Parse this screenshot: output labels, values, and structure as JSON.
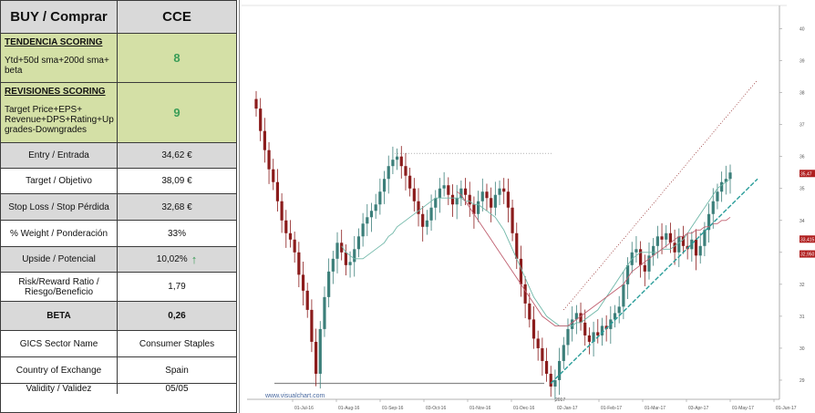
{
  "table": {
    "header": {
      "label": "BUY / Comprar",
      "ticker": "CCE"
    },
    "tendencia": {
      "title": "TENDENCIA SCORING",
      "description": "Ytd+50d sma+200d  sma+ beta",
      "value": "8"
    },
    "revisiones": {
      "title": "REVISIONES SCORING",
      "description": "Target Price+EPS+ Revenue+DPS+Rating+Up grades-Downgrades",
      "value": "9"
    },
    "rows": [
      {
        "label": "Entry / Entrada",
        "value": "34,62 €"
      },
      {
        "label": "Target / Objetivo",
        "value": "38,09 €"
      },
      {
        "label": "Stop Loss / Stop Pérdida",
        "value": "32,68 €"
      },
      {
        "label": "% Weight / Ponderación",
        "value": "33%"
      },
      {
        "label": "Upside / Potencial",
        "value": "10,02%"
      },
      {
        "label": "Risk/Reward  Ratio / Riesgo/Beneficio",
        "value": "1,79"
      },
      {
        "label": "BETA",
        "value": "0,26"
      },
      {
        "label": "GICS Sector Name",
        "value": "Consumer Staples"
      },
      {
        "label": "Country of Exchange",
        "value": "Spain"
      },
      {
        "label": "Validity / Validez",
        "value": "05/05"
      }
    ]
  },
  "icons": {
    "upside_arrow": "up-arrow-icon"
  },
  "colors": {
    "green_fill": "#d4e0a6",
    "gray_fill": "#d9d9d9",
    "score_green": "#3a9d57",
    "candle_up": "#3c7f7a",
    "candle_down": "#8b1c1c",
    "sma50": "#6fb7a8",
    "sma200": "#c06070",
    "trendline": "#2a9d9a"
  },
  "chart_data": {
    "type": "candlestick",
    "watermark": "www.visualchart.com",
    "y_ticks": [
      29,
      30,
      31,
      32,
      33,
      34,
      35,
      36,
      37,
      38,
      39,
      40
    ],
    "ylim": [
      28.4,
      40.5
    ],
    "x_ticks": [
      "01-Jul-16",
      "01-Aug-16",
      "01-Sep-16",
      "03-Oct-16",
      "01-Nov-16",
      "01-Dec-16",
      "02-Jan-17",
      "01-Feb-17",
      "01-Mar-17",
      "03-Apr-17",
      "01-May-17",
      "01-Jun-17"
    ],
    "year_label": "2017",
    "price_tags": [
      {
        "label": "35,47",
        "value": 35.47
      },
      {
        "label": "33,415",
        "value": 33.415
      },
      {
        "label": "32,950",
        "value": 32.95
      }
    ],
    "close": [
      37.5,
      36.8,
      36.2,
      35.6,
      35.2,
      34.6,
      34.0,
      33.6,
      33.4,
      33.0,
      32.3,
      31.8,
      31.2,
      30.2,
      29.2,
      30.6,
      31.6,
      32.4,
      32.8,
      33.3,
      33.0,
      32.6,
      32.7,
      33.1,
      33.5,
      33.9,
      34.1,
      34.3,
      34.5,
      34.9,
      35.3,
      35.7,
      35.9,
      36.0,
      35.7,
      35.4,
      35.0,
      34.6,
      34.2,
      33.8,
      34.0,
      34.4,
      34.7,
      35.0,
      35.1,
      34.8,
      34.5,
      34.7,
      35.0,
      34.8,
      34.5,
      34.2,
      34.6,
      34.9,
      34.7,
      34.4,
      34.8,
      35.0,
      34.9,
      34.4,
      33.6,
      32.8,
      32.0,
      31.4,
      30.9,
      30.3,
      30.0,
      29.6,
      29.2,
      28.8,
      29.0,
      29.6,
      30.1,
      30.6,
      30.9,
      31.1,
      30.8,
      30.4,
      30.2,
      30.5,
      30.4,
      30.7,
      30.6,
      30.9,
      31.1,
      31.3,
      32.0,
      32.6,
      33.0,
      33.1,
      32.6,
      32.4,
      32.9,
      33.2,
      33.5,
      33.4,
      33.6,
      33.3,
      33.0,
      33.5,
      33.2,
      33.1,
      33.4,
      32.9,
      33.2,
      33.7,
      34.2,
      34.6,
      34.9,
      35.2,
      35.3,
      35.5
    ],
    "sma50": [
      null,
      null,
      null,
      null,
      null,
      null,
      null,
      null,
      null,
      null,
      null,
      null,
      null,
      null,
      null,
      null,
      null,
      null,
      null,
      null,
      33.2,
      33.0,
      32.9,
      32.8,
      32.8,
      32.8,
      32.9,
      33.0,
      33.1,
      33.2,
      33.3,
      33.5,
      33.6,
      33.8,
      33.9,
      34.0,
      34.1,
      34.2,
      34.3,
      34.4,
      34.5,
      34.6,
      34.7,
      34.7,
      34.7,
      34.7,
      34.7,
      34.7,
      34.7,
      34.6,
      34.6,
      34.5,
      34.5,
      34.4,
      34.3,
      34.2,
      34.1,
      33.9,
      33.7,
      33.4,
      33.1,
      32.8,
      32.5,
      32.2,
      31.9,
      31.6,
      31.4,
      31.2,
      31.0,
      30.9,
      30.8,
      30.7,
      30.7,
      30.7,
      30.7,
      30.8,
      30.8,
      30.9,
      31.0,
      31.1,
      31.2,
      31.4,
      31.6,
      31.8,
      32.0,
      32.2,
      32.4,
      32.6,
      32.8,
      32.9,
      33.0,
      33.0,
      33.0,
      33.0,
      33.0,
      33.1,
      33.1,
      33.1,
      33.2,
      33.3,
      33.4,
      33.6,
      33.8,
      34.0,
      34.2,
      34.4,
      34.6,
      34.8,
      35.0,
      35.1,
      35.2,
      35.3
    ],
    "sma200": [
      null,
      null,
      null,
      null,
      null,
      null,
      null,
      null,
      null,
      null,
      null,
      null,
      null,
      null,
      null,
      null,
      null,
      null,
      null,
      null,
      null,
      null,
      null,
      null,
      null,
      null,
      null,
      null,
      null,
      null,
      null,
      null,
      null,
      null,
      null,
      null,
      null,
      null,
      null,
      null,
      null,
      null,
      null,
      null,
      null,
      null,
      null,
      34.9,
      34.8,
      34.6,
      34.4,
      34.2,
      34.0,
      33.8,
      33.6,
      33.4,
      33.2,
      33.0,
      32.8,
      32.6,
      32.4,
      32.2,
      32.0,
      31.8,
      31.6,
      31.4,
      31.2,
      31.0,
      30.9,
      30.8,
      30.7,
      30.7,
      30.7,
      30.7,
      30.8,
      30.9,
      31.0,
      31.1,
      31.2,
      31.3,
      31.4,
      31.5,
      31.6,
      31.7,
      31.8,
      31.9,
      32.0,
      32.2,
      32.4,
      32.5,
      32.6,
      32.7,
      32.8,
      32.9,
      33.0,
      33.1,
      33.2,
      33.3,
      33.4,
      33.5,
      33.5,
      33.6,
      33.6,
      33.7,
      33.7,
      33.8,
      33.8,
      33.9,
      33.9,
      34.0,
      34.0,
      34.1
    ]
  }
}
